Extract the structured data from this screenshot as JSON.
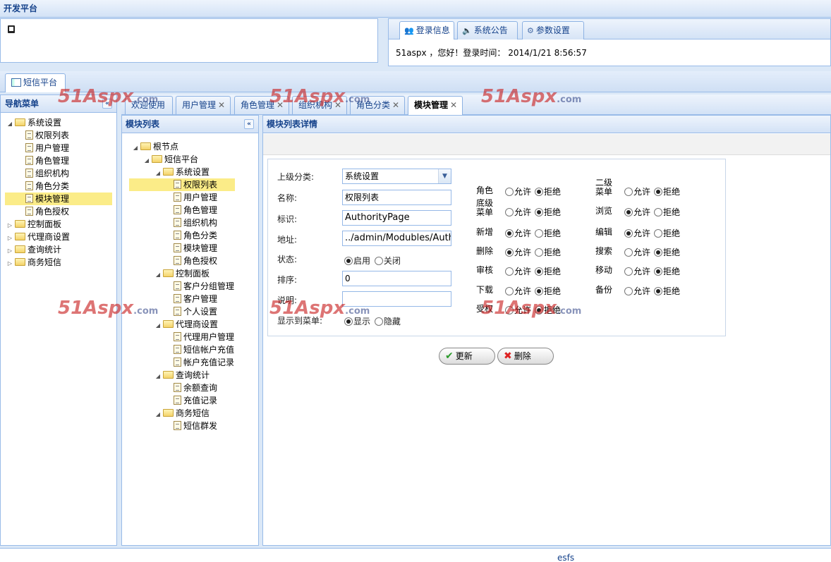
{
  "app_title": "开发平台",
  "top_right": {
    "tabs": [
      {
        "label": "登录信息",
        "icon": "users-icon",
        "active": true
      },
      {
        "label": "系统公告",
        "icon": "speaker-icon",
        "active": false
      },
      {
        "label": "参数设置",
        "icon": "gear-icon",
        "active": false
      }
    ],
    "login_text": "51aspx ，您好！登录时间： 2014/1/21 8:56:57"
  },
  "platform_tab": "短信平台",
  "nav": {
    "title": "导航菜单",
    "items": [
      {
        "label": "系统设置",
        "type": "folder",
        "expanded": true,
        "level": 0
      },
      {
        "label": "权限列表",
        "type": "doc",
        "level": 1
      },
      {
        "label": "用户管理",
        "type": "doc",
        "level": 1
      },
      {
        "label": "角色管理",
        "type": "doc",
        "level": 1
      },
      {
        "label": "组织机构",
        "type": "doc",
        "level": 1
      },
      {
        "label": "角色分类",
        "type": "doc",
        "level": 1
      },
      {
        "label": "模块管理",
        "type": "doc",
        "level": 1,
        "selected": true
      },
      {
        "label": "角色授权",
        "type": "doc",
        "level": 1
      },
      {
        "label": "控制面板",
        "type": "folder",
        "expanded": false,
        "level": 0
      },
      {
        "label": "代理商设置",
        "type": "folder",
        "expanded": false,
        "level": 0
      },
      {
        "label": "查询统计",
        "type": "folder",
        "expanded": false,
        "level": 0
      },
      {
        "label": "商务短信",
        "type": "folder",
        "expanded": false,
        "level": 0
      }
    ]
  },
  "tabs": [
    {
      "label": "欢迎使用",
      "closable": false
    },
    {
      "label": "用户管理",
      "closable": true
    },
    {
      "label": "角色管理",
      "closable": true
    },
    {
      "label": "组织机构",
      "closable": true
    },
    {
      "label": "角色分类",
      "closable": true
    },
    {
      "label": "模块管理",
      "closable": true,
      "active": true
    }
  ],
  "module_list": {
    "title": "模块列表",
    "items": [
      {
        "label": "根节点",
        "type": "folder",
        "level": 0
      },
      {
        "label": "短信平台",
        "type": "folder",
        "level": 1
      },
      {
        "label": "系统设置",
        "type": "folder",
        "level": 2
      },
      {
        "label": "权限列表",
        "type": "doc",
        "level": 3,
        "selected": true
      },
      {
        "label": "用户管理",
        "type": "doc",
        "level": 3
      },
      {
        "label": "角色管理",
        "type": "doc",
        "level": 3
      },
      {
        "label": "组织机构",
        "type": "doc",
        "level": 3
      },
      {
        "label": "角色分类",
        "type": "doc",
        "level": 3
      },
      {
        "label": "模块管理",
        "type": "doc",
        "level": 3
      },
      {
        "label": "角色授权",
        "type": "doc",
        "level": 3
      },
      {
        "label": "控制面板",
        "type": "folder",
        "level": 2
      },
      {
        "label": "客户分组管理",
        "type": "doc",
        "level": 3
      },
      {
        "label": "客户管理",
        "type": "doc",
        "level": 3
      },
      {
        "label": "个人设置",
        "type": "doc",
        "level": 3
      },
      {
        "label": "代理商设置",
        "type": "folder",
        "level": 2
      },
      {
        "label": "代理用户管理",
        "type": "doc",
        "level": 3
      },
      {
        "label": "短信帐户充值",
        "type": "doc",
        "level": 3
      },
      {
        "label": "帐户充值记录",
        "type": "doc",
        "level": 3
      },
      {
        "label": "查询统计",
        "type": "folder",
        "level": 2
      },
      {
        "label": "余额查询",
        "type": "doc",
        "level": 3
      },
      {
        "label": "充值记录",
        "type": "doc",
        "level": 3
      },
      {
        "label": "商务短信",
        "type": "folder",
        "level": 2
      },
      {
        "label": "短信群发",
        "type": "doc",
        "level": 3
      }
    ]
  },
  "detail": {
    "title": "模块列表详情",
    "form": {
      "parent_label": "上级分类:",
      "parent_value": "系统设置",
      "name_label": "名称:",
      "name_value": "权限列表",
      "code_label": "标识:",
      "code_value": "AuthorityPage",
      "url_label": "地址:",
      "url_value": "../admin/Modubles/Authority",
      "status_label": "状态:",
      "status_on": "启用",
      "status_off": "关闭",
      "sort_label": "排序:",
      "sort_value": "0",
      "desc_label": "说明:",
      "desc_value": "",
      "show_label": "显示到菜单:",
      "show_yes": "显示",
      "show_no": "隐藏"
    },
    "allow": "允许",
    "deny": "拒绝",
    "perms_left": [
      {
        "name": "角色",
        "allowed": false
      },
      {
        "name": "底级菜单",
        "allowed": false
      },
      {
        "name": "新增",
        "allowed": true
      },
      {
        "name": "删除",
        "allowed": true
      },
      {
        "name": "审核",
        "allowed": false
      },
      {
        "name": "下载",
        "allowed": false
      },
      {
        "name": "受权",
        "allowed": false
      }
    ],
    "perms_right": [
      {
        "name": "二级菜单",
        "allowed": false
      },
      {
        "name": "浏览",
        "allowed": true
      },
      {
        "name": "编辑",
        "allowed": true
      },
      {
        "name": "搜索",
        "allowed": false
      },
      {
        "name": "移动",
        "allowed": false
      },
      {
        "name": "备份",
        "allowed": false
      }
    ],
    "update_label": "更新",
    "delete_label": "删除"
  },
  "footer": "esfs",
  "watermark": {
    "main": "51Aspx",
    "suffix": ".com"
  }
}
